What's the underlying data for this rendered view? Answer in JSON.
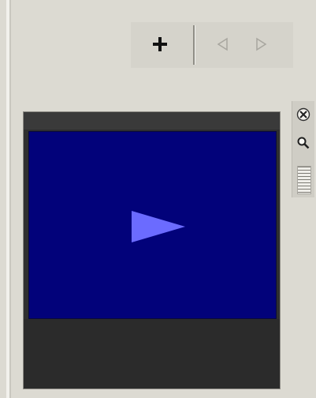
{
  "toolbar": {
    "add_icon": "plus-icon",
    "prev_icon": "triangle-left-icon",
    "next_icon": "triangle-right-icon"
  },
  "video": {
    "play_icon": "play-icon",
    "screen_color": "#02027a",
    "play_color": "#6b6bff"
  },
  "side_tools": {
    "close_icon": "close-x-icon",
    "search_icon": "magnifier-icon",
    "grip_icon": "resize-grip-icon"
  }
}
